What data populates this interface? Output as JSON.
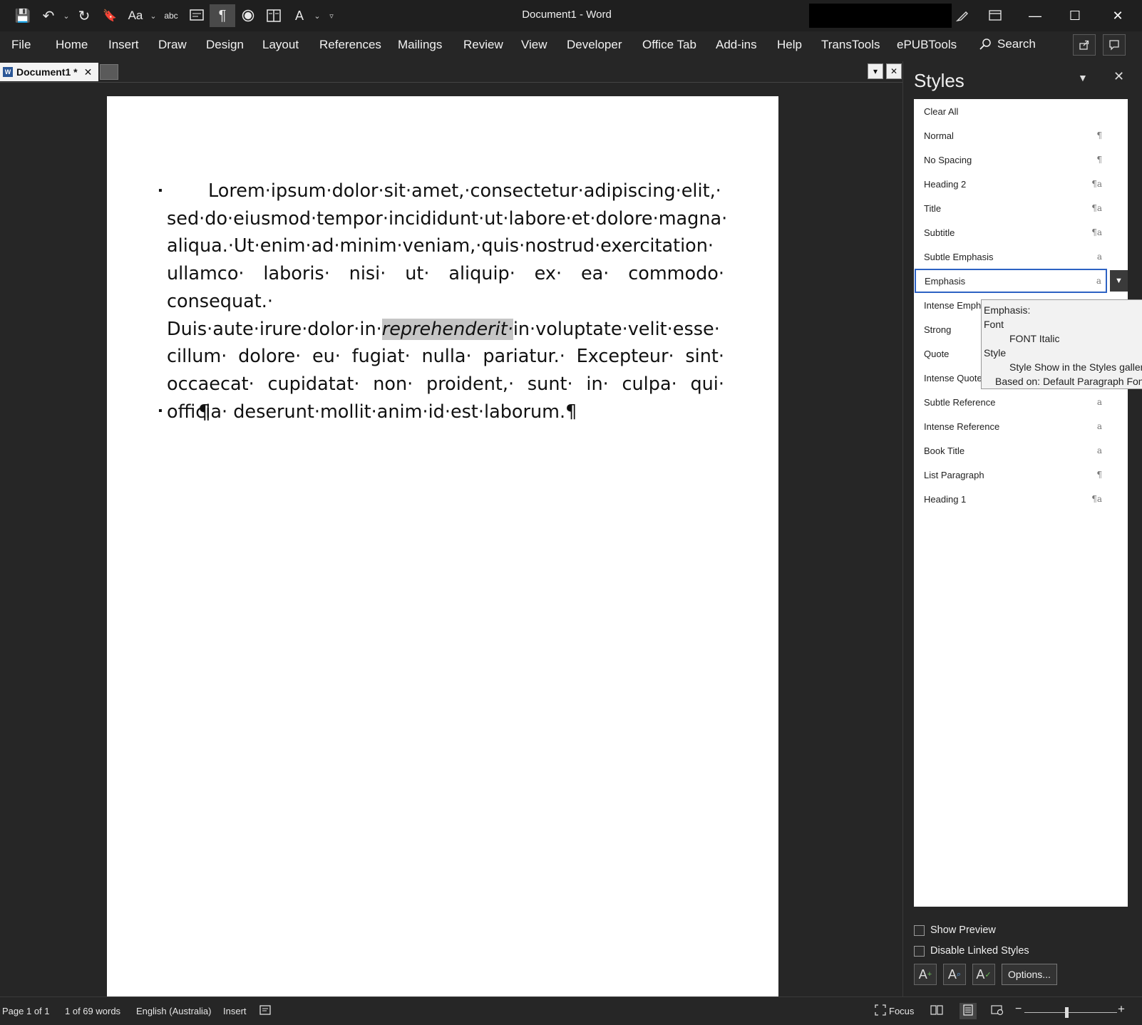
{
  "window": {
    "title": "Document1  -  Word",
    "controls": {
      "minimize": "—",
      "maximize": "☐",
      "close": "✕"
    }
  },
  "qat": {
    "save_icon": "💾",
    "undo_icon": "↶",
    "redo_icon": "↻",
    "bookmark_icon": "🔖",
    "font_case_label": "Aa",
    "spelling_icon": "abc",
    "pilcrow": "¶",
    "dropdown": "⌄"
  },
  "menu": {
    "tabs": [
      "File",
      "Home",
      "Insert",
      "Draw",
      "Design",
      "Layout",
      "References",
      "Mailings",
      "Review",
      "View",
      "Developer",
      "Office Tab",
      "Add-ins",
      "Help",
      "TransTools",
      "ePUBTools"
    ],
    "search_label": "Search"
  },
  "doc_tab": {
    "label": "Document1 *",
    "close": "✕"
  },
  "document": {
    "before": "Lorem·ipsum·dolor·sit·amet,·consectetur·adipiscing·elit,· sed·do·eiusmod·tempor·incididunt·ut·labore·et·dolore·magna· aliqua.·Ut·enim·ad·minim·veniam,·quis·nostrud·exercitation· ullamco· laboris· nisi· ut· aliquip· ex· ea· commodo· consequat.· Duis·aute·irure·dolor·in·",
    "highlight": "reprehenderit·",
    "after": "in·voluptate·velit·esse· cillum· dolore· eu· fugiat· nulla· pariatur.· Excepteur· sint· occaecat· cupidatat· non· proident,· sunt· in· culpa· qui· officia· deserunt·mollit·anim·id·est·laborum.¶",
    "empty_para": "¶",
    "bullet": "▪"
  },
  "styles_pane": {
    "title": "Styles",
    "items": [
      {
        "label": "Clear All",
        "mark": ""
      },
      {
        "label": "Normal",
        "mark": "¶"
      },
      {
        "label": "No Spacing",
        "mark": "¶"
      },
      {
        "label": "Heading 2",
        "mark": "¶a"
      },
      {
        "label": "Title",
        "mark": "¶a"
      },
      {
        "label": "Subtitle",
        "mark": "¶a"
      },
      {
        "label": "Subtle Emphasis",
        "mark": "a"
      },
      {
        "label": "Emphasis",
        "mark": "a"
      },
      {
        "label": "Intense Emphasis",
        "mark": "a"
      },
      {
        "label": "Strong",
        "mark": "a"
      },
      {
        "label": "Quote",
        "mark": "¶a"
      },
      {
        "label": "Intense Quote",
        "mark": "¶a"
      },
      {
        "label": "Subtle Reference",
        "mark": "a"
      },
      {
        "label": "Intense Reference",
        "mark": "a"
      },
      {
        "label": "Book Title",
        "mark": "a"
      },
      {
        "label": "List Paragraph",
        "mark": "¶"
      },
      {
        "label": "Heading 1",
        "mark": "¶a"
      }
    ],
    "selected": "Emphasis",
    "show_preview": "Show Preview",
    "disable_linked": "Disable Linked Styles",
    "options_button": "Options..."
  },
  "tooltip": {
    "line1": "Emphasis:",
    "line2": "Font",
    "line3": "FONT  Italic",
    "line4": "Style",
    "line5": "Style Show in the Styles gallery",
    "line6": "Based on: Default Paragraph Font"
  },
  "status": {
    "page": "Page 1 of 1",
    "words": "1 of 69 words",
    "language": "English (Australia)",
    "mode": "Insert",
    "focus": "Focus"
  }
}
